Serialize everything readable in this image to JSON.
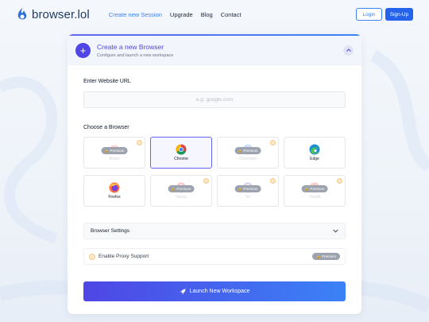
{
  "nav": {
    "logo_text": "browser.lol",
    "links": [
      "Create new Session",
      "Upgrade",
      "Blog",
      "Contact"
    ],
    "login_label": "Login",
    "signup_label": "Sign-Up"
  },
  "card": {
    "title": "Create a new Browser",
    "subtitle": "Configure and launch a new workspace"
  },
  "url": {
    "label": "Enter Website URL",
    "placeholder": "e.g. google.com"
  },
  "browsers": {
    "label": "Choose a Browser",
    "premium_label": "Premium",
    "items": [
      {
        "name": "Brave",
        "locked": true,
        "selected": false,
        "icon": "brave-icon"
      },
      {
        "name": "Chrome",
        "locked": false,
        "selected": true,
        "icon": "chrome-icon"
      },
      {
        "name": "Chromium",
        "locked": true,
        "selected": false,
        "icon": "chromium-icon"
      },
      {
        "name": "Edge",
        "locked": false,
        "selected": false,
        "icon": "edge-icon"
      },
      {
        "name": "Firefox",
        "locked": false,
        "selected": false,
        "icon": "firefox-icon"
      },
      {
        "name": "Opera",
        "locked": true,
        "selected": false,
        "icon": "opera-icon"
      },
      {
        "name": "Tor",
        "locked": true,
        "selected": false,
        "icon": "tor-icon"
      },
      {
        "name": "Vivaldi",
        "locked": true,
        "selected": false,
        "icon": "vivaldi-icon"
      }
    ]
  },
  "settings": {
    "label": "Browser Settings"
  },
  "proxy": {
    "label": "Enable Proxy Support",
    "badge": "Premium"
  },
  "launch": {
    "label": "Launch New Workspace"
  },
  "colors": {
    "accent": "#4f46e5",
    "brand": "#2563eb",
    "premium": "#9ca3af"
  }
}
